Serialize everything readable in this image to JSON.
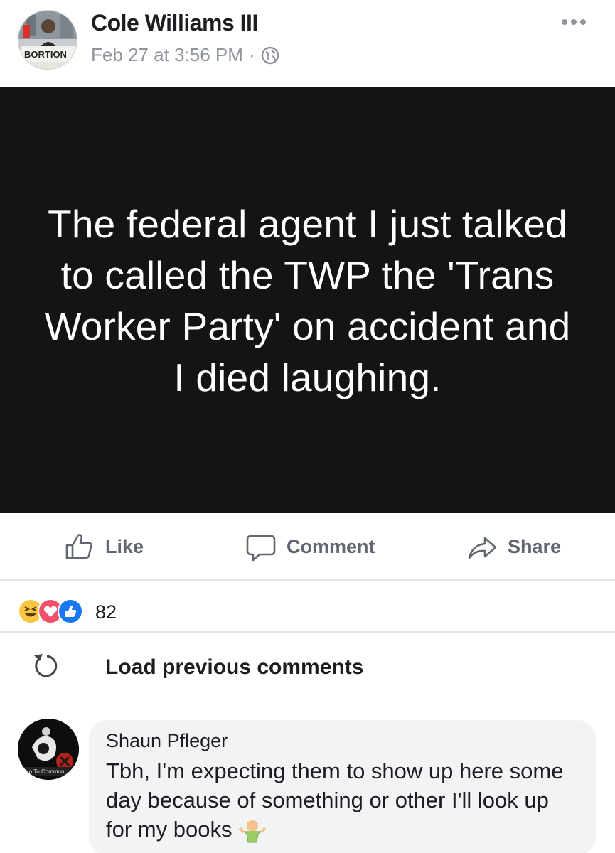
{
  "post": {
    "author": "Cole Williams III",
    "timestamp": "Feb 27 at 3:56 PM",
    "separator": "·",
    "privacy_icon": "globe-icon",
    "body_text": "The federal agent I just talked to called the TWP the 'Trans Worker Party' on accident and I died laughing.",
    "background_color": "#141414",
    "text_color": "#ffffff",
    "avatar_sign_text": "BORTION"
  },
  "actions": {
    "like_label": "Like",
    "comment_label": "Comment",
    "share_label": "Share"
  },
  "reactions": {
    "icons": [
      "haha",
      "love",
      "like"
    ],
    "count": "82"
  },
  "comments": {
    "load_previous_label": "Load previous comments",
    "items": [
      {
        "author": "Shaun Pfleger",
        "text": "Tbh, I'm expecting them to show up here some day because of something or other I'll look up for my books",
        "avatar_caption": "No To Commun"
      }
    ]
  },
  "colors": {
    "meta_gray": "#90949c",
    "action_gray": "#606770",
    "bubble_bg": "#f2f3f5",
    "divider": "#e5e6e9",
    "like_blue": "#1877f2",
    "love_red": "#f25268",
    "haha_yellow": "#f7c743"
  }
}
